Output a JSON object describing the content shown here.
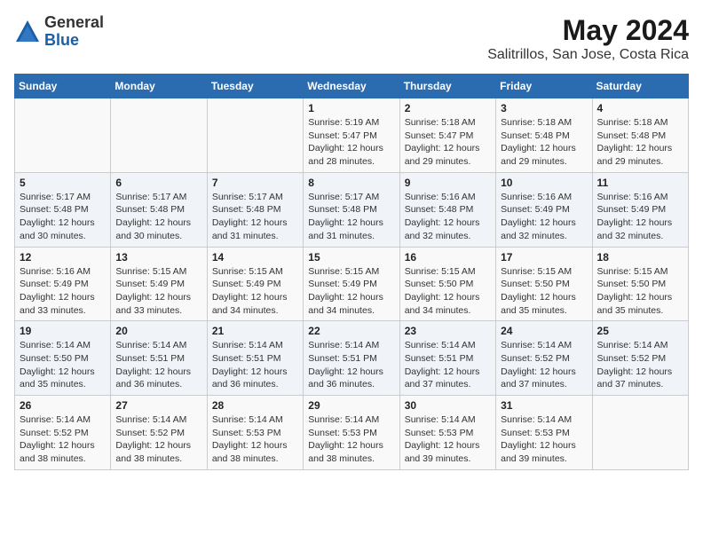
{
  "logo": {
    "general": "General",
    "blue": "Blue"
  },
  "header": {
    "title": "May 2024",
    "subtitle": "Salitrillos, San Jose, Costa Rica"
  },
  "days_of_week": [
    "Sunday",
    "Monday",
    "Tuesday",
    "Wednesday",
    "Thursday",
    "Friday",
    "Saturday"
  ],
  "weeks": [
    [
      {
        "day": "",
        "info": ""
      },
      {
        "day": "",
        "info": ""
      },
      {
        "day": "",
        "info": ""
      },
      {
        "day": "1",
        "info": "Sunrise: 5:19 AM\nSunset: 5:47 PM\nDaylight: 12 hours\nand 28 minutes."
      },
      {
        "day": "2",
        "info": "Sunrise: 5:18 AM\nSunset: 5:47 PM\nDaylight: 12 hours\nand 29 minutes."
      },
      {
        "day": "3",
        "info": "Sunrise: 5:18 AM\nSunset: 5:48 PM\nDaylight: 12 hours\nand 29 minutes."
      },
      {
        "day": "4",
        "info": "Sunrise: 5:18 AM\nSunset: 5:48 PM\nDaylight: 12 hours\nand 29 minutes."
      }
    ],
    [
      {
        "day": "5",
        "info": "Sunrise: 5:17 AM\nSunset: 5:48 PM\nDaylight: 12 hours\nand 30 minutes."
      },
      {
        "day": "6",
        "info": "Sunrise: 5:17 AM\nSunset: 5:48 PM\nDaylight: 12 hours\nand 30 minutes."
      },
      {
        "day": "7",
        "info": "Sunrise: 5:17 AM\nSunset: 5:48 PM\nDaylight: 12 hours\nand 31 minutes."
      },
      {
        "day": "8",
        "info": "Sunrise: 5:17 AM\nSunset: 5:48 PM\nDaylight: 12 hours\nand 31 minutes."
      },
      {
        "day": "9",
        "info": "Sunrise: 5:16 AM\nSunset: 5:48 PM\nDaylight: 12 hours\nand 32 minutes."
      },
      {
        "day": "10",
        "info": "Sunrise: 5:16 AM\nSunset: 5:49 PM\nDaylight: 12 hours\nand 32 minutes."
      },
      {
        "day": "11",
        "info": "Sunrise: 5:16 AM\nSunset: 5:49 PM\nDaylight: 12 hours\nand 32 minutes."
      }
    ],
    [
      {
        "day": "12",
        "info": "Sunrise: 5:16 AM\nSunset: 5:49 PM\nDaylight: 12 hours\nand 33 minutes."
      },
      {
        "day": "13",
        "info": "Sunrise: 5:15 AM\nSunset: 5:49 PM\nDaylight: 12 hours\nand 33 minutes."
      },
      {
        "day": "14",
        "info": "Sunrise: 5:15 AM\nSunset: 5:49 PM\nDaylight: 12 hours\nand 34 minutes."
      },
      {
        "day": "15",
        "info": "Sunrise: 5:15 AM\nSunset: 5:49 PM\nDaylight: 12 hours\nand 34 minutes."
      },
      {
        "day": "16",
        "info": "Sunrise: 5:15 AM\nSunset: 5:50 PM\nDaylight: 12 hours\nand 34 minutes."
      },
      {
        "day": "17",
        "info": "Sunrise: 5:15 AM\nSunset: 5:50 PM\nDaylight: 12 hours\nand 35 minutes."
      },
      {
        "day": "18",
        "info": "Sunrise: 5:15 AM\nSunset: 5:50 PM\nDaylight: 12 hours\nand 35 minutes."
      }
    ],
    [
      {
        "day": "19",
        "info": "Sunrise: 5:14 AM\nSunset: 5:50 PM\nDaylight: 12 hours\nand 35 minutes."
      },
      {
        "day": "20",
        "info": "Sunrise: 5:14 AM\nSunset: 5:51 PM\nDaylight: 12 hours\nand 36 minutes."
      },
      {
        "day": "21",
        "info": "Sunrise: 5:14 AM\nSunset: 5:51 PM\nDaylight: 12 hours\nand 36 minutes."
      },
      {
        "day": "22",
        "info": "Sunrise: 5:14 AM\nSunset: 5:51 PM\nDaylight: 12 hours\nand 36 minutes."
      },
      {
        "day": "23",
        "info": "Sunrise: 5:14 AM\nSunset: 5:51 PM\nDaylight: 12 hours\nand 37 minutes."
      },
      {
        "day": "24",
        "info": "Sunrise: 5:14 AM\nSunset: 5:52 PM\nDaylight: 12 hours\nand 37 minutes."
      },
      {
        "day": "25",
        "info": "Sunrise: 5:14 AM\nSunset: 5:52 PM\nDaylight: 12 hours\nand 37 minutes."
      }
    ],
    [
      {
        "day": "26",
        "info": "Sunrise: 5:14 AM\nSunset: 5:52 PM\nDaylight: 12 hours\nand 38 minutes."
      },
      {
        "day": "27",
        "info": "Sunrise: 5:14 AM\nSunset: 5:52 PM\nDaylight: 12 hours\nand 38 minutes."
      },
      {
        "day": "28",
        "info": "Sunrise: 5:14 AM\nSunset: 5:53 PM\nDaylight: 12 hours\nand 38 minutes."
      },
      {
        "day": "29",
        "info": "Sunrise: 5:14 AM\nSunset: 5:53 PM\nDaylight: 12 hours\nand 38 minutes."
      },
      {
        "day": "30",
        "info": "Sunrise: 5:14 AM\nSunset: 5:53 PM\nDaylight: 12 hours\nand 39 minutes."
      },
      {
        "day": "31",
        "info": "Sunrise: 5:14 AM\nSunset: 5:53 PM\nDaylight: 12 hours\nand 39 minutes."
      },
      {
        "day": "",
        "info": ""
      }
    ]
  ]
}
